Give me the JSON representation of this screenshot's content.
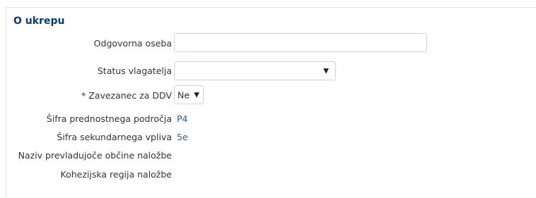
{
  "section": {
    "title": "O ukrepu"
  },
  "fields": {
    "odgovorna_oseba": {
      "label": "Odgovorna oseba",
      "value": "",
      "placeholder": ""
    },
    "status_vlagatelja": {
      "label": "Status vlagatelja",
      "selected": "",
      "icon": "chevron-down-icon"
    },
    "zavezanec_ddv": {
      "label": "* Zavezanec za DDV",
      "selected": "Ne",
      "icon": "chevron-down-icon"
    },
    "sifra_prednostnega": {
      "label": "Šifra prednostnega področja",
      "value": "P4"
    },
    "sifra_sekundarnega": {
      "label": "Šifra sekundarnega vpliva",
      "value": "5e"
    },
    "naziv_obcine": {
      "label": "Naziv prevladujoče občine naložbe",
      "value": ""
    },
    "kohezijska_regija": {
      "label": "Kohezijska regija naložbe",
      "value": ""
    }
  },
  "colors": {
    "title": "#0b3c6b",
    "label": "#333333",
    "value": "#2a5f8f",
    "border": "#c9d3df"
  }
}
